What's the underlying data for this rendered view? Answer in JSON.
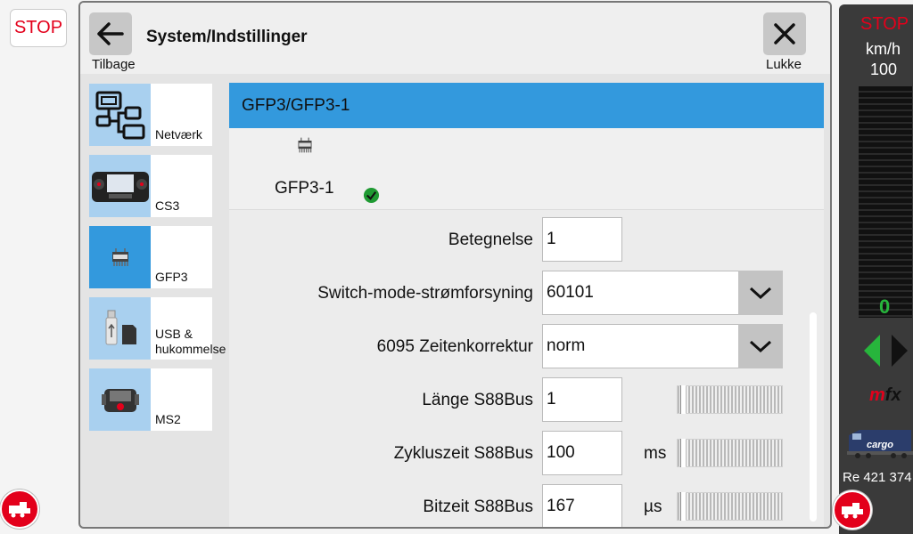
{
  "stop_button": "STOP",
  "dialog": {
    "title": "System/Indstillinger",
    "back_label": "Tilbage",
    "close_label": "Lukke"
  },
  "sidebar": {
    "items": [
      {
        "label": "Netværk",
        "icon": "network-icon"
      },
      {
        "label": "CS3",
        "icon": "cs3-device-icon"
      },
      {
        "label": "GFP3",
        "icon": "gfp3-chip-icon"
      },
      {
        "label": "USB & hukommelse",
        "icon": "usb-memory-icon"
      },
      {
        "label": "MS2",
        "icon": "ms2-device-icon"
      }
    ]
  },
  "section": {
    "header": "GFP3/GFP3-1",
    "device_name": "GFP3-1",
    "device_status": "ok"
  },
  "fields": {
    "betegnelse": {
      "label": "Betegnelse",
      "value": "1"
    },
    "power_supply": {
      "label": "Switch-mode-strømforsyning",
      "value": "60101"
    },
    "zeitenkorrektur": {
      "label": "6095 Zeitenkorrektur",
      "value": "norm"
    },
    "laenge_s88": {
      "label": "Länge S88Bus",
      "value": "1",
      "level": 0.03
    },
    "zykluszeit_s88": {
      "label": "Zykluszeit S88Bus",
      "value": "100",
      "unit": "ms",
      "level": 0.03
    },
    "bitzeit_s88": {
      "label": "Bitzeit S88Bus",
      "value": "167",
      "unit": "µs",
      "level": 0.03
    }
  },
  "right_panel": {
    "stop": "STOP",
    "unit": "km/h",
    "max_speed": "100",
    "speed": "0",
    "protocol": "mfx",
    "loco_name": "Re 421 374",
    "loco_tag": "cargo"
  },
  "colors": {
    "accent": "#3399dd",
    "stop_red": "#e3001b",
    "ok_green": "#27b53c"
  }
}
